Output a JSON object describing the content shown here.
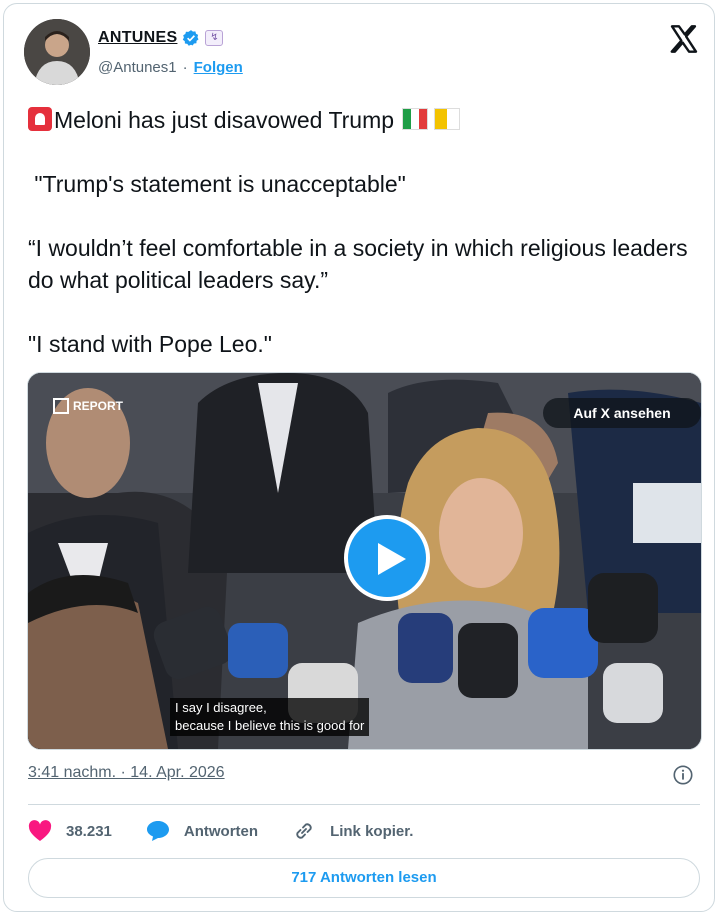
{
  "author": {
    "name": "ANTUNES",
    "handle": "@Antunes1",
    "separator": "·",
    "follow_label": "Folgen"
  },
  "icons": {
    "verified": "verified-badge-icon",
    "affiliation": "affiliate-badge-icon",
    "brand": "x-logo-icon",
    "siren": "siren-emoji",
    "flag_italy": "italy-flag-emoji",
    "flag_vatican": "vatican-flag-emoji",
    "play": "play-icon",
    "info": "info-icon",
    "like": "heart-icon",
    "reply": "speech-bubble-icon",
    "link": "link-icon"
  },
  "tweet": {
    "line1": "Meloni has just disavowed Trump",
    "line2": " \"Trump's statement is unacceptable\"",
    "line3": "“I wouldn’t feel comfortable in a society in which religious leaders do what political leaders say.”",
    "line4": "\"I stand with Pope Leo.\""
  },
  "media": {
    "watch_label": "Auf X ansehen",
    "channel_logo": "REPORT",
    "subtitle_line1": "I say I disagree,",
    "subtitle_line2": "because I believe this is good for"
  },
  "meta": {
    "timestamp": "3:41 nachm. · 14. Apr. 2026"
  },
  "actions": {
    "likes": "38.231",
    "reply_label": "Antworten",
    "copy_link_label": "Link kopier."
  },
  "footer": {
    "read_replies": "717 Antworten lesen"
  },
  "colors": {
    "accent": "#1d9bf0",
    "like": "#f91880",
    "text": "#0f1419",
    "muted": "#536471",
    "border": "#cfd9de"
  }
}
